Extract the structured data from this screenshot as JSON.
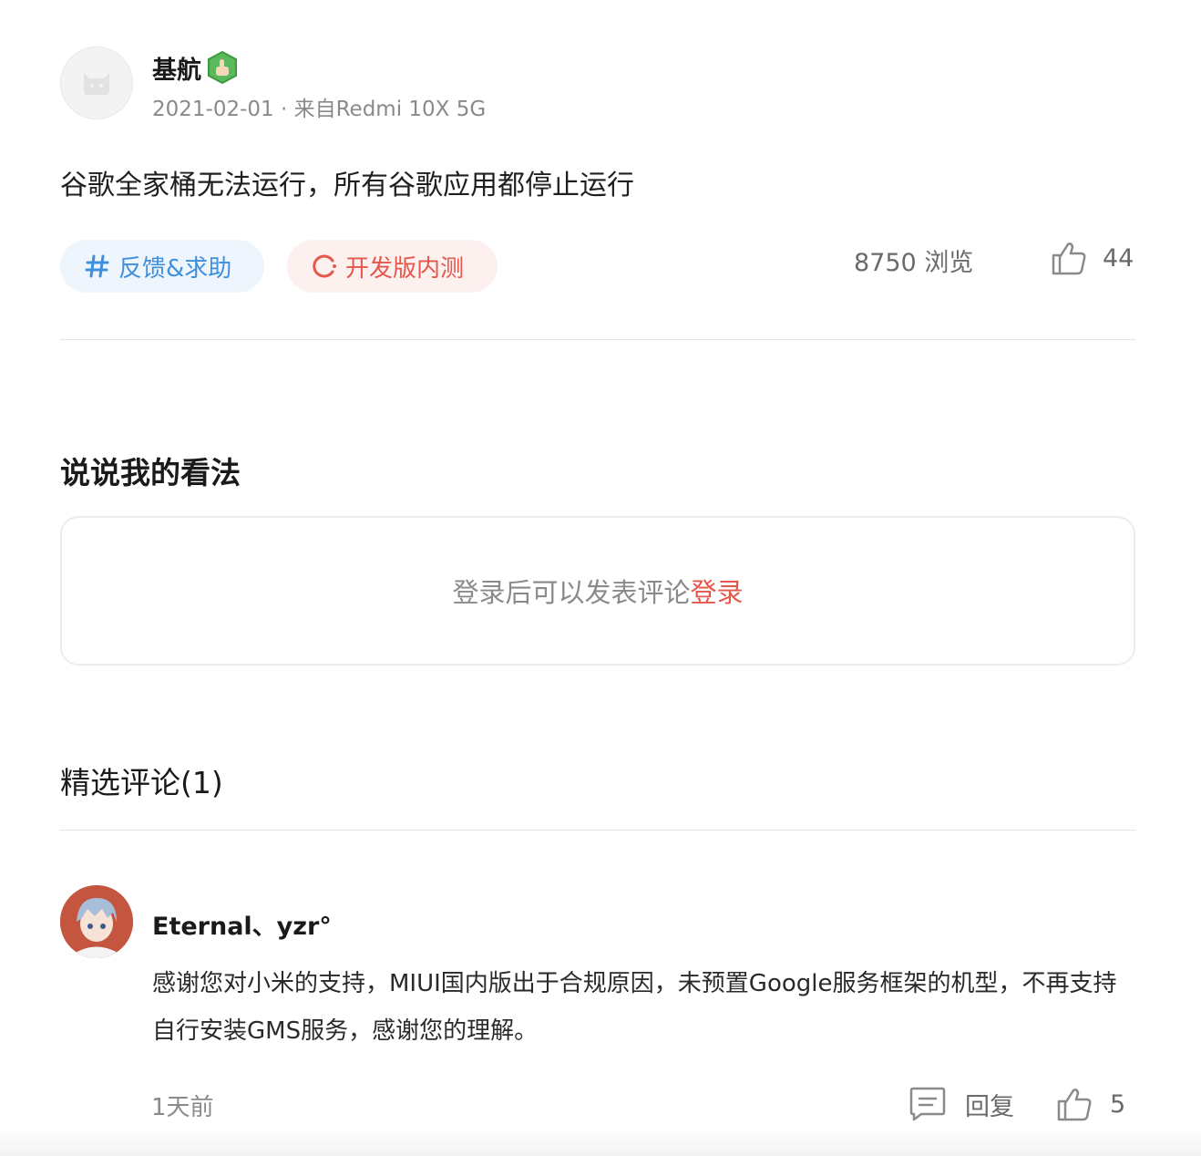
{
  "post": {
    "author": "基航",
    "author_badge_icon": "finger-badge-icon",
    "avatar_icon": "mi-bunny-avatar-icon",
    "meta": "2021-02-01 · 来自Redmi 10X 5G",
    "title": "谷歌全家桶无法运行，所有谷歌应用都停止运行",
    "tags": [
      {
        "label": "反馈&求助",
        "icon": "hash-icon",
        "color": "#3f8fe0"
      },
      {
        "label": "开发版内测",
        "icon": "refresh-icon",
        "color": "#e5574a"
      }
    ],
    "views_count": "8750",
    "views_label": "浏览",
    "like_count": "44"
  },
  "comment_section": {
    "title": "说说我的看法",
    "prompt": "登录后可以发表评论",
    "login_label": "登录"
  },
  "featured": {
    "title": "精选评论(1)",
    "comments": [
      {
        "author": "Eternal、yzr°",
        "body": "感谢您对小米的支持，MIUI国内版出于合规原因，未预置Google服务框架的机型，不再支持自行安装GMS服务，感谢您的理解。",
        "time": "1天前",
        "reply_label": "回复",
        "like_count": "5"
      }
    ]
  },
  "colors": {
    "accent_red": "#e5574a",
    "accent_blue": "#3f8fe0"
  }
}
